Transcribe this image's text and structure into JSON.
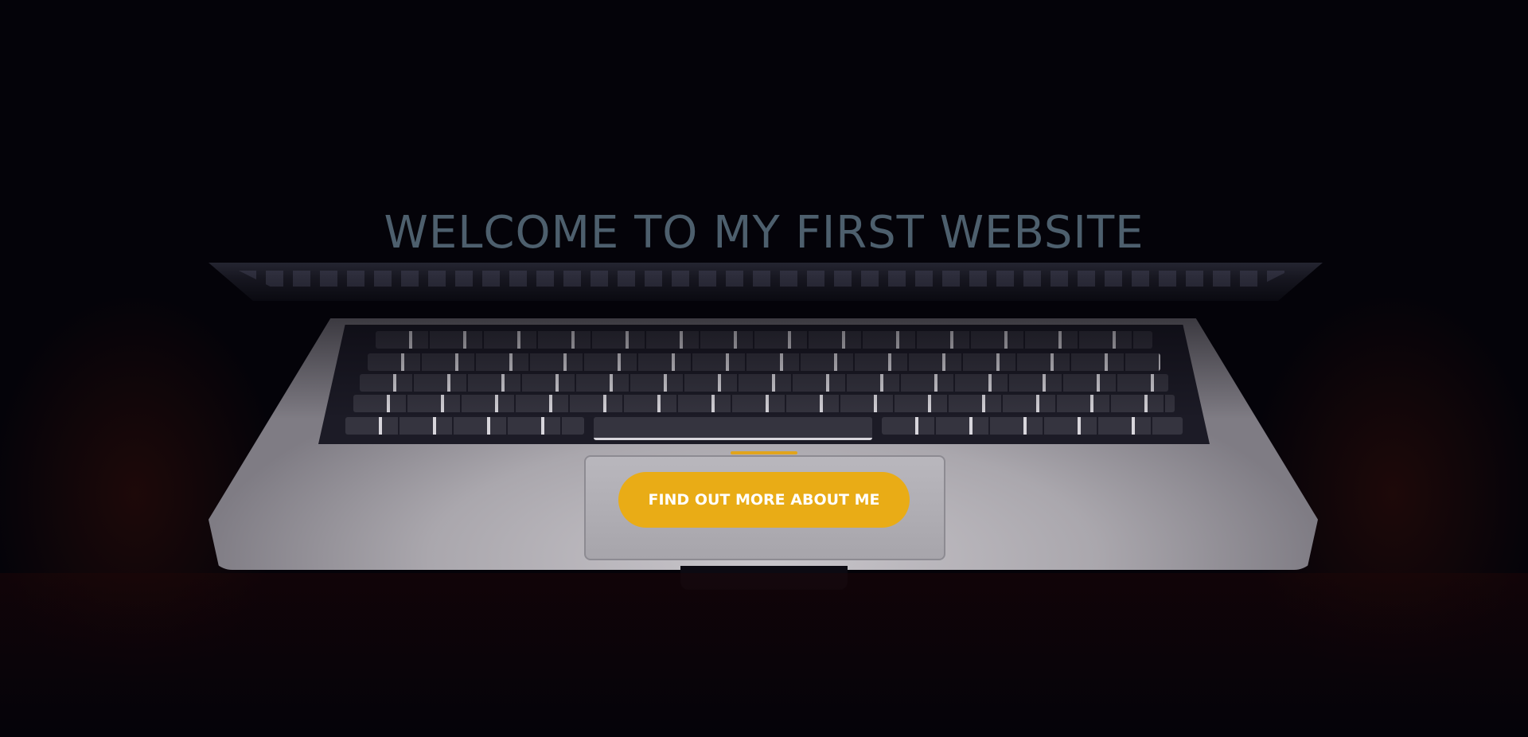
{
  "hero": {
    "title": "WELCOME TO MY FIRST WEBSITE",
    "cta_label": "FIND OUT MORE ABOUT ME",
    "background_image": "laptop-keyboard-dark-photo"
  },
  "colors": {
    "background": "#040309",
    "title": "#4d5f6d",
    "accent": "#e9ac16",
    "button_text": "#ffffff"
  }
}
